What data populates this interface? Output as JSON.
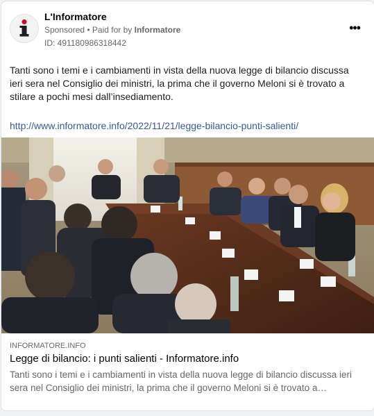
{
  "post": {
    "page_name": "L'Informatore",
    "sponsored": "Sponsored",
    "paid_for_prefix": " • Paid for by ",
    "paid_for_name": "Informatore",
    "ad_id": "ID: 491180986318442",
    "more_label": "•••",
    "text": "Tanti sono i temi e i cambiamenti in vista della nuova legge di bilancio discussa ieri sera nel Consiglio dei ministri, la prima che il governo Meloni si è trovato a stilare a pochi mesi dall’insediamento.",
    "url": "http://www.informatore.info/2022/11/21/legge-bilancio-punti-salienti/"
  },
  "link_preview": {
    "domain": "INFORMATORE.INFO",
    "title": "Legge di bilancio: i punti salienti - Informatore.info",
    "description": "Tanti sono i temi e i cambiamenti in vista della nuova legge di bilancio discussa ieri sera nel Consiglio dei ministri, la prima che il governo Meloni si è trovato a…"
  },
  "colors": {
    "link": "#385898",
    "avatar_icon": "#c8102e",
    "muted_text": "#65676b"
  },
  "icons": {
    "avatar": "info-i-icon",
    "more": "more-options-icon"
  }
}
